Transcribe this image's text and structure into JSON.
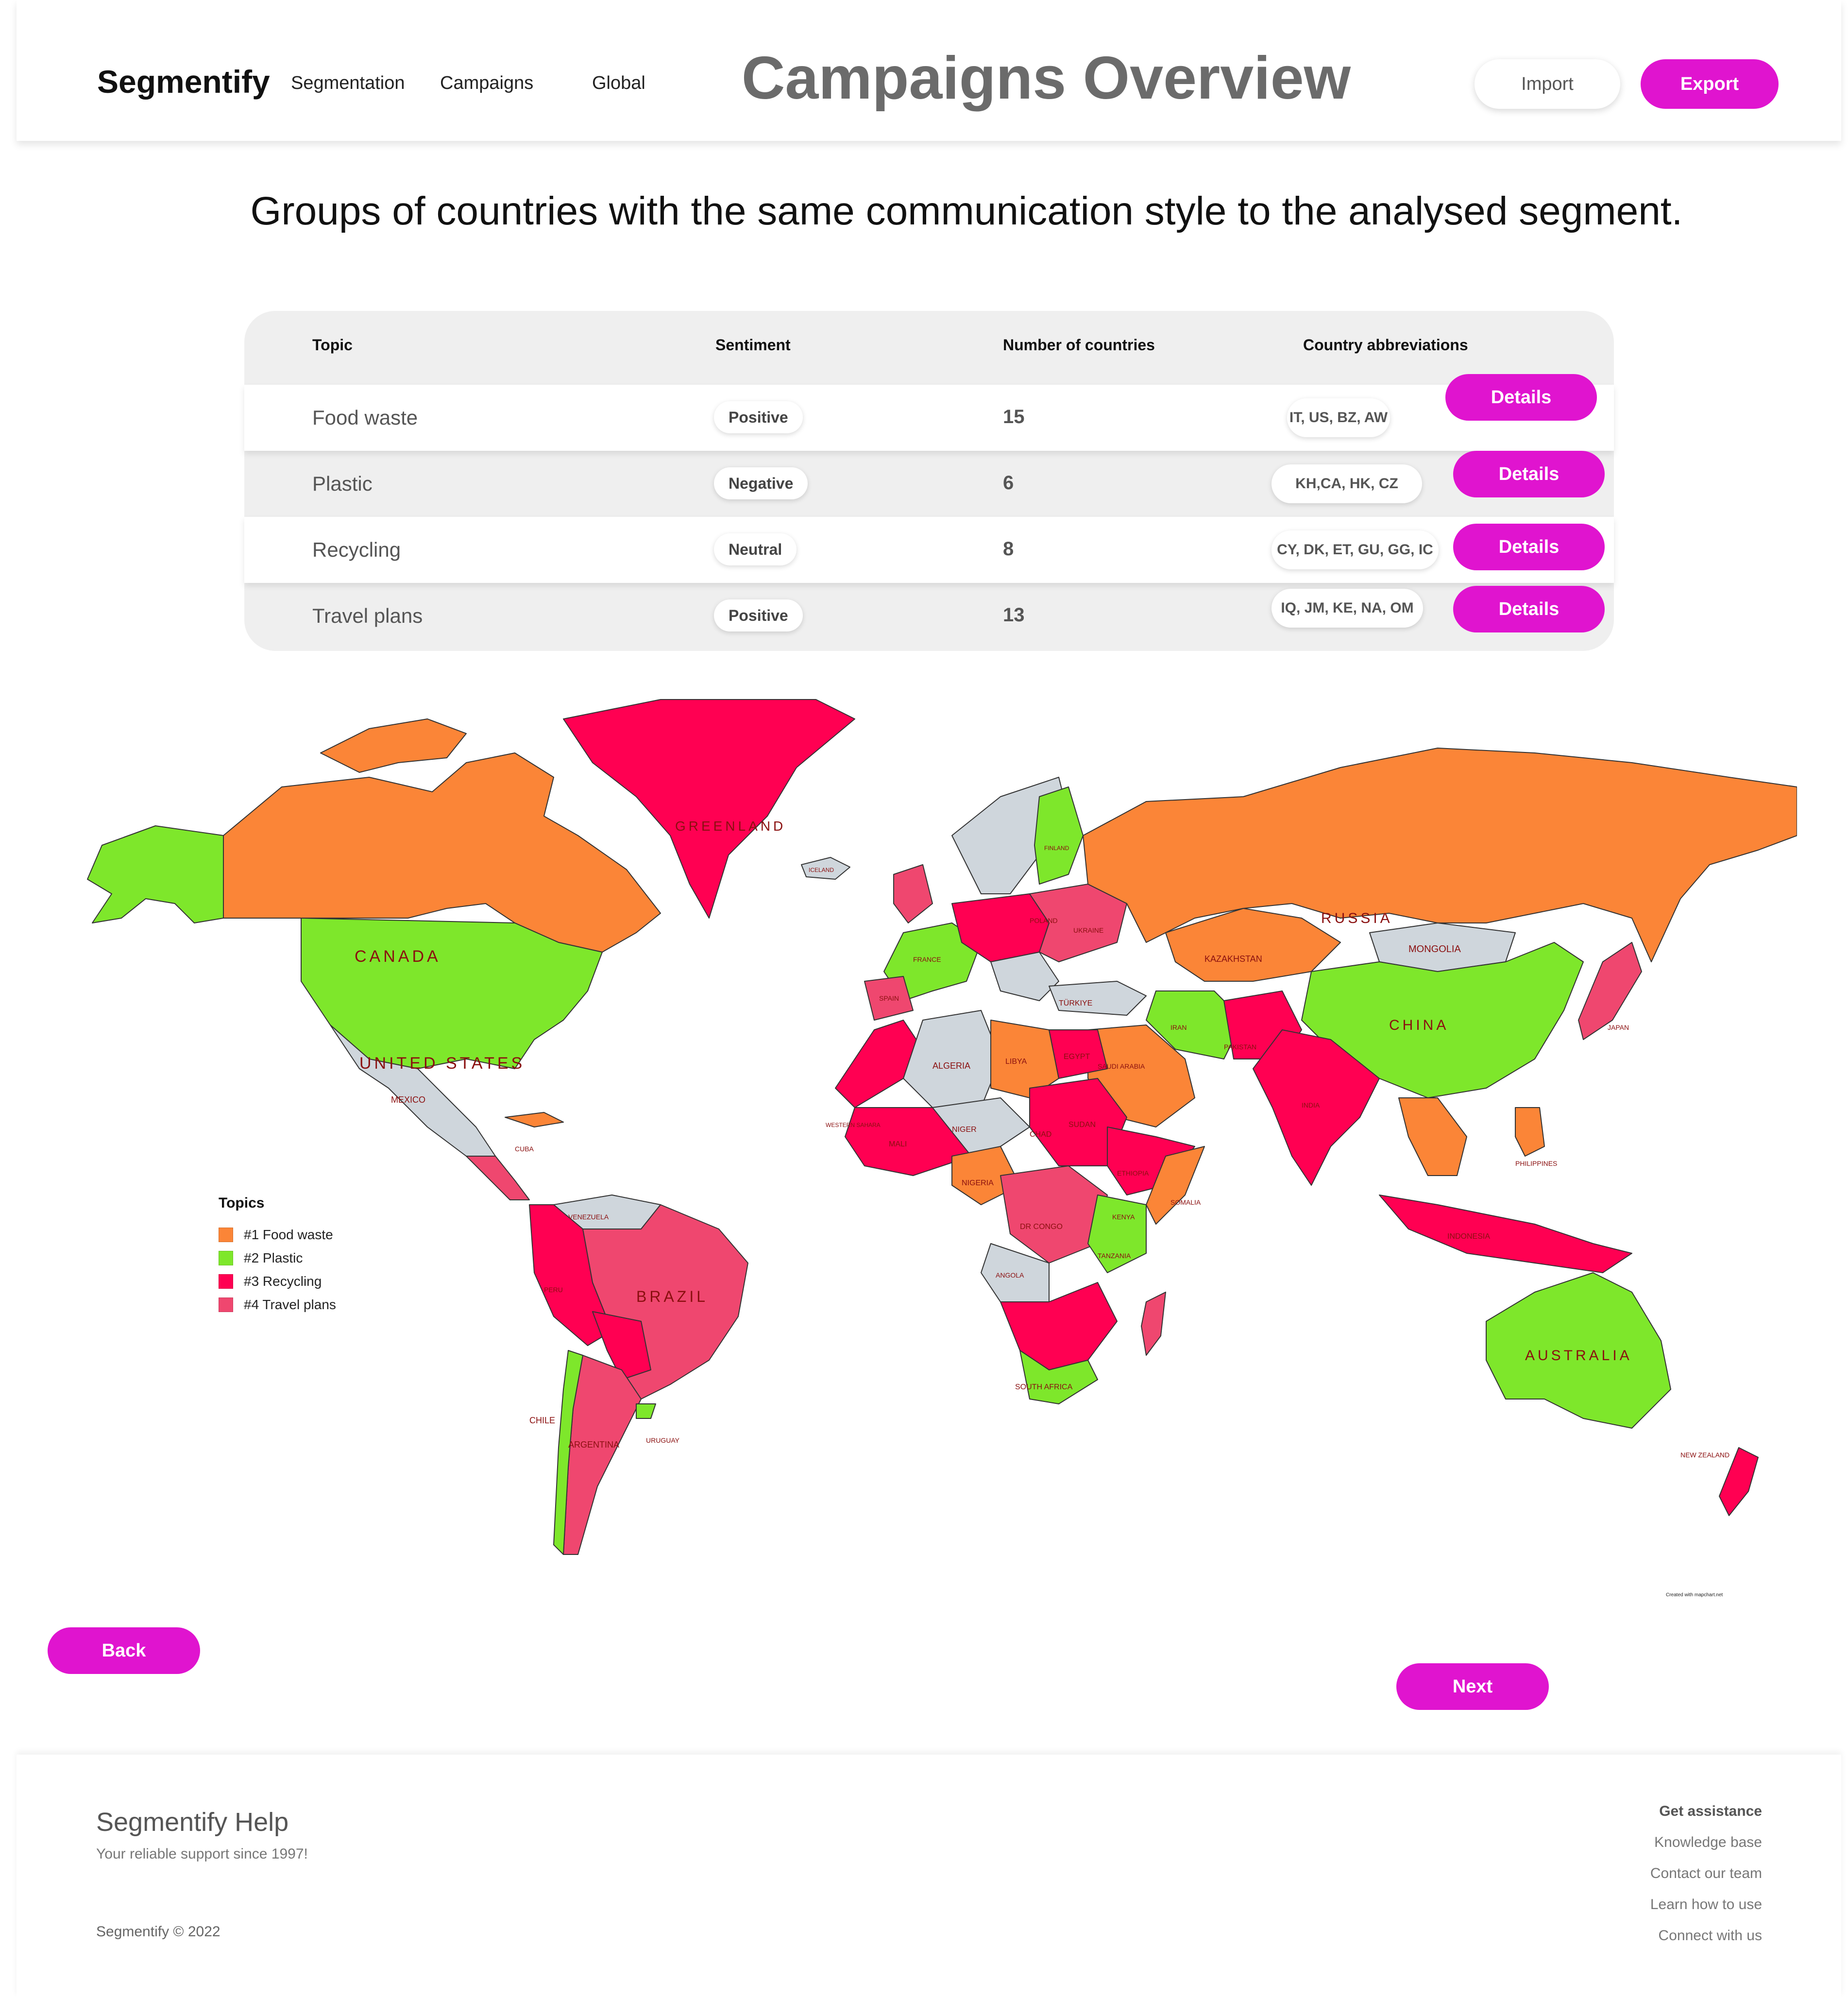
{
  "header": {
    "brand": "Segmentify",
    "nav": [
      "Segmentation",
      "Campaigns",
      "Global"
    ],
    "title": "Campaigns Overview",
    "import_label": "Import",
    "export_label": "Export"
  },
  "subtitle": "Groups of countries with the same communication style to the analysed segment.",
  "table": {
    "headers": [
      "Topic",
      "Sentiment",
      "Number of countries",
      "Country abbreviations"
    ],
    "rows": [
      {
        "topic": "Food waste",
        "sentiment": "Positive",
        "count": "15",
        "abbr": "IT, US, BZ, AW",
        "action": "Details"
      },
      {
        "topic": "Plastic",
        "sentiment": "Negative",
        "count": "6",
        "abbr": "KH,CA, HK, CZ",
        "action": "Details"
      },
      {
        "topic": "Recycling",
        "sentiment": "Neutral",
        "count": "8",
        "abbr": "CY, DK, ET, GU, GG, IC",
        "action": "Details"
      },
      {
        "topic": "Travel plans",
        "sentiment": "Positive",
        "count": "13",
        "abbr": "IQ, JM, KE, NA, OM",
        "action": "Details"
      }
    ]
  },
  "map": {
    "colors": {
      "food_waste": "#fb8537",
      "plastic": "#7ee72b",
      "recycling": "#ff0052",
      "travel_plans": "#ef476f",
      "none": "#cfd6dc"
    },
    "labels": {
      "greenland": "GREENLAND",
      "canada": "CANADA",
      "united_states": "UNITED STATES",
      "mexico": "MEXICO",
      "russia": "RUSSIA",
      "kazakhstan": "KAZAKHSTAN",
      "mongolia": "MONGOLIA",
      "china": "CHINA",
      "brazil": "BRAZIL",
      "argentina": "ARGENTINA",
      "chile": "CHILE",
      "uruguay": "URUGUAY",
      "australia": "AUSTRALIA",
      "new_zealand": "NEW ZEALAND",
      "india": "INDIA",
      "iran": "IRAN",
      "algeria": "ALGERIA",
      "libya": "LIBYA",
      "egypt": "EGYPT",
      "sudan": "SUDAN",
      "chad": "CHAD",
      "niger": "NIGER",
      "mali": "MALI",
      "nigeria": "NIGERIA",
      "ethiopia": "ETHIOPIA",
      "somalia": "SOMALIA",
      "kenya": "KENYA",
      "tanzania": "TANZANIA",
      "dr_congo": "DR CONGO",
      "angola": "ANGOLA",
      "south_africa": "SOUTH AFRICA",
      "saudi_arabia": "SAUDI ARABIA",
      "turkiye": "TÜRKIYE",
      "pakistan": "PAKISTAN",
      "japan": "JAPAN",
      "philippines": "PHILIPPINES",
      "indonesia": "INDONESIA",
      "finland": "FINLAND",
      "ukraine": "UKRAINE",
      "poland": "POLAND",
      "france": "FRANCE",
      "spain": "SPAIN",
      "venezuela": "VENEZUELA",
      "peru": "PERU",
      "iceland": "ICELAND",
      "cuba": "CUBA",
      "western_sahara": "WESTERN SAHARA"
    },
    "legend": {
      "title": "Topics",
      "items": [
        {
          "label": "#1 Food waste",
          "color": "#fb8537"
        },
        {
          "label": "#2 Plastic",
          "color": "#7ee72b"
        },
        {
          "label": "#3 Recycling",
          "color": "#ff0052"
        },
        {
          "label": "#4 Travel plans",
          "color": "#ef476f"
        }
      ]
    },
    "credit": "Created with mapchart.net"
  },
  "buttons": {
    "back": "Back",
    "next": "Next"
  },
  "footer": {
    "title": "Segmentify Help",
    "tagline": "Your reliable support since 1997!",
    "copyright": "Segmentify © 2022",
    "links_heading": "Get assistance",
    "links": [
      "Knowledge base",
      "Contact our team",
      "Learn how to use",
      "Connect with us"
    ]
  }
}
